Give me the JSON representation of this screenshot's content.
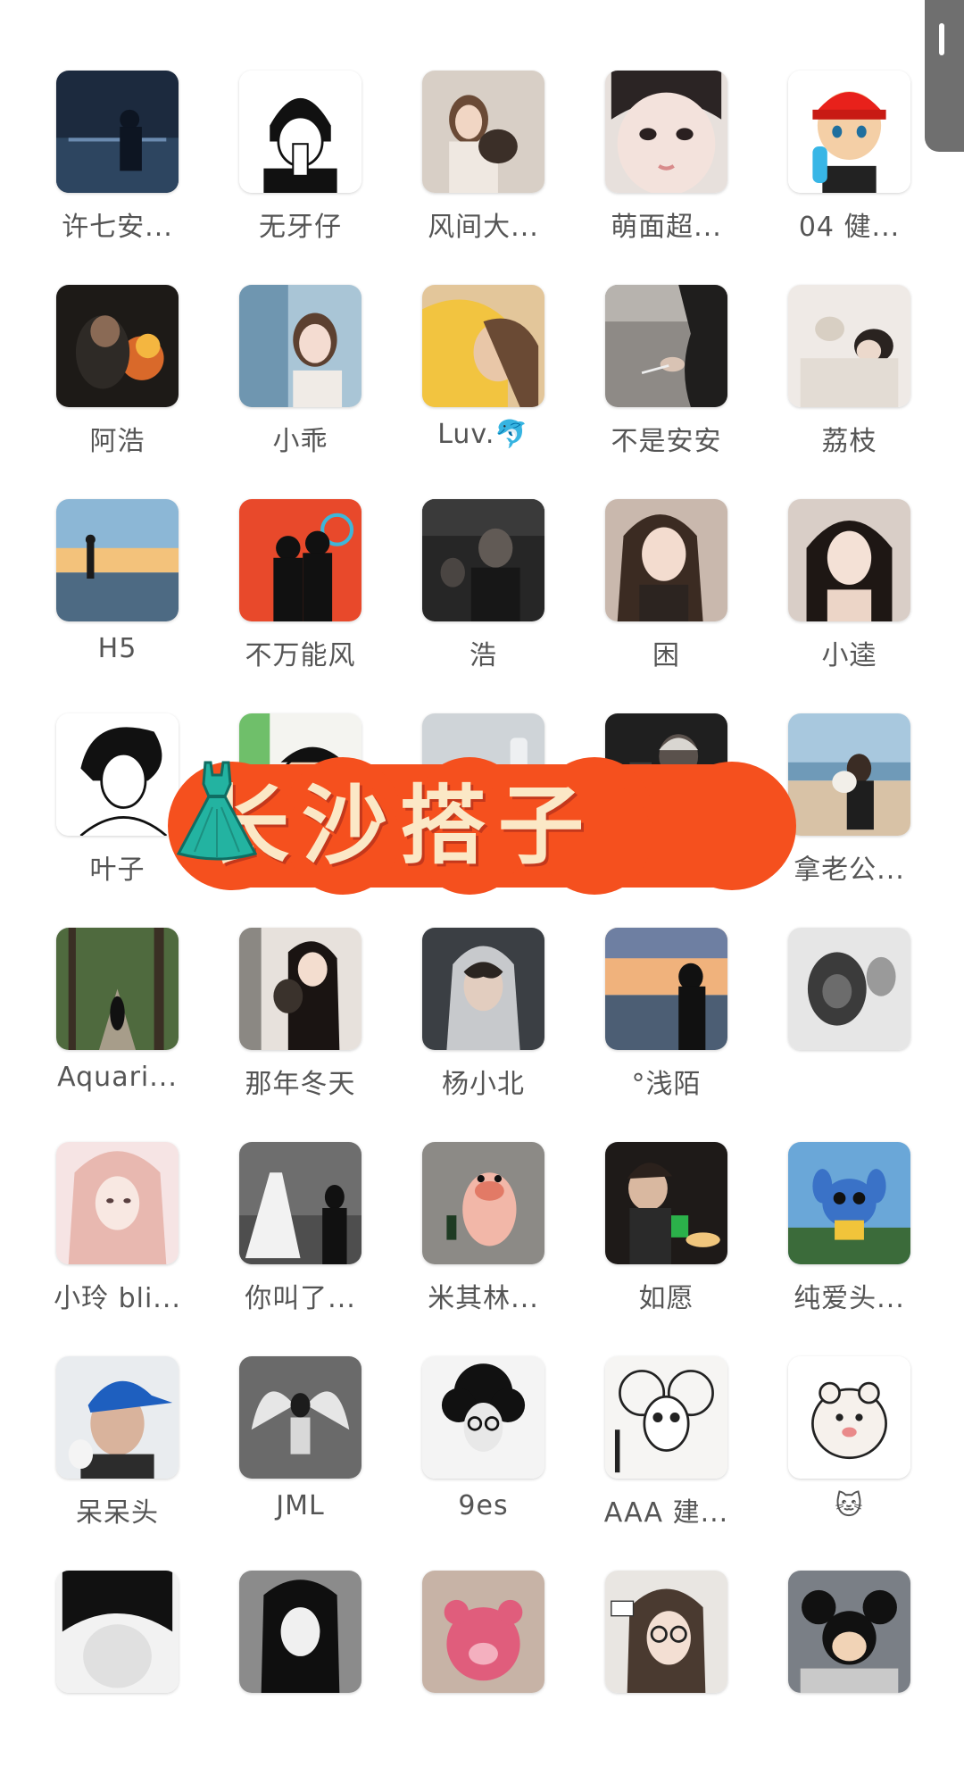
{
  "banner": {
    "text": "长沙搭子",
    "emoji": "👗"
  },
  "contacts": [
    {
      "name": "许七安...",
      "art": "lake-night"
    },
    {
      "name": "无牙仔",
      "art": "manga-bob"
    },
    {
      "name": "风间大...",
      "art": "girl-puppy"
    },
    {
      "name": "萌面超...",
      "art": "face-close"
    },
    {
      "name": "04 健...",
      "art": "cartoon-redhat"
    },
    {
      "name": "阿浩",
      "art": "fire-night"
    },
    {
      "name": "小乖",
      "art": "girl-window"
    },
    {
      "name": "Luv.🐬",
      "art": "golden-hair"
    },
    {
      "name": "不是安安",
      "art": "hand-beach"
    },
    {
      "name": "荔枝",
      "art": "girl-pets"
    },
    {
      "name": "H5",
      "art": "sunset-figure"
    },
    {
      "name": "不万能风",
      "art": "red-silhouette"
    },
    {
      "name": "浩",
      "art": "dark-room"
    },
    {
      "name": "困",
      "art": "girl-portrait"
    },
    {
      "name": "小逵",
      "art": "girl-portrait-2"
    },
    {
      "name": "叶子",
      "art": "manga-boy"
    },
    {
      "name": "",
      "art": "cartoon-green"
    },
    {
      "name": "",
      "art": "grey-sky"
    },
    {
      "name": "",
      "art": "dark-selfie"
    },
    {
      "name": "拿老公...",
      "art": "beach-hug"
    },
    {
      "name": "Aquari...",
      "art": "forest-path"
    },
    {
      "name": "那年冬天",
      "art": "girl-cat"
    },
    {
      "name": "杨小北",
      "art": "hood-boy"
    },
    {
      "name": "°浅陌",
      "art": "sunset-beach"
    },
    {
      "name": "",
      "art": "ape"
    },
    {
      "name": "小玲 bli...",
      "art": "pink-girl"
    },
    {
      "name": "你叫了...",
      "art": "wedding-dress"
    },
    {
      "name": "米其林...",
      "art": "pink-toy"
    },
    {
      "name": "如愿",
      "art": "boy-dinner"
    },
    {
      "name": "纯爱头...",
      "art": "stitch"
    },
    {
      "name": "呆呆头",
      "art": "blue-cap"
    },
    {
      "name": "JML",
      "art": "bw-wings"
    },
    {
      "name": "9es",
      "art": "bw-curly"
    },
    {
      "name": "AAA 建...",
      "art": "mouse-sketch"
    },
    {
      "name": "🐱",
      "art": "hamster"
    },
    {
      "name": "",
      "art": "dark-hair"
    },
    {
      "name": "",
      "art": "bw-girl"
    },
    {
      "name": "",
      "art": "lotso"
    },
    {
      "name": "",
      "art": "glasses-girl"
    },
    {
      "name": "",
      "art": "mickey"
    }
  ]
}
